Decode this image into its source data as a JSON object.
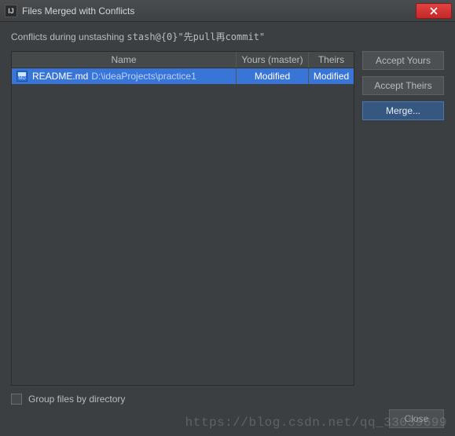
{
  "window": {
    "title": "Files Merged with Conflicts",
    "icon_label": "IJ"
  },
  "subtitle": {
    "prefix": "Conflicts during unstashing ",
    "mono": "stash@{0}\"先pull再commit\""
  },
  "table": {
    "headers": {
      "name": "Name",
      "yours": "Yours (master)",
      "theirs": "Theirs"
    },
    "rows": [
      {
        "icon_badge": "MD",
        "filename": "README.md",
        "filepath": "D:\\ideaProjects\\practice1",
        "yours": "Modified",
        "theirs": "Modified"
      }
    ]
  },
  "buttons": {
    "accept_yours": "Accept Yours",
    "accept_theirs": "Accept Theirs",
    "merge": "Merge...",
    "close": "Close"
  },
  "checkbox": {
    "label": "Group files by directory"
  },
  "watermark": "https://blog.csdn.net/qq_33039699"
}
